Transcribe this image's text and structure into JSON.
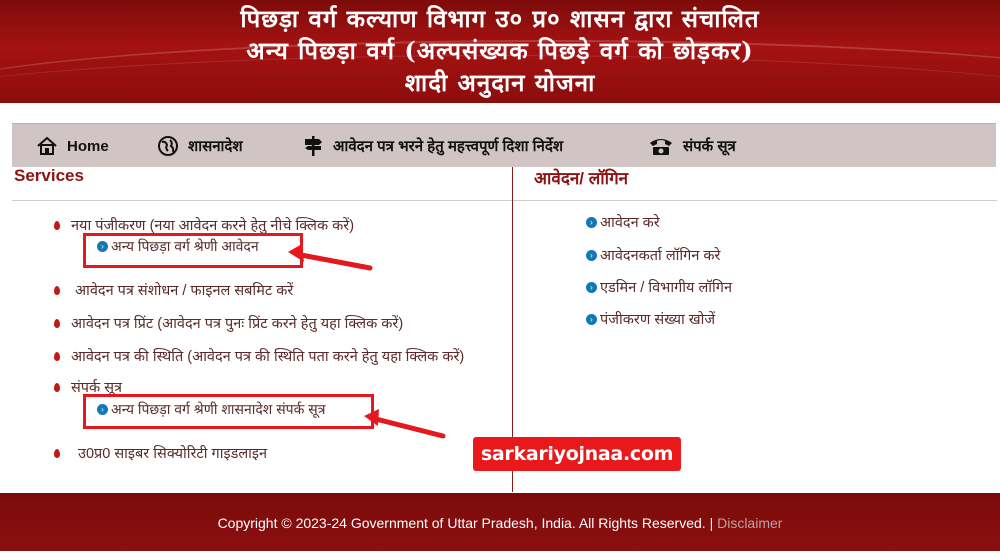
{
  "header": {
    "line1": "पिछड़ा  वर्ग कल्याण विभाग उ० प्र० शासन द्वारा संचालित",
    "line2": "अन्य पिछड़ा वर्ग (अल्पसंख्यक पिछड़े वर्ग को छोड़कर)",
    "line3": "शादी अनुदान योजना"
  },
  "nav": {
    "home": "Home",
    "shasanadesh": "शासनादेश",
    "guidelines": "आवेदन पत्र भरने हेतु महत्त्वपूर्ण दिशा निर्देश",
    "contact": "संपर्क सूत्र"
  },
  "services": {
    "title": "Services",
    "items": [
      "नया पंजीकरण (नया आवेदन करने हेतु नीचे क्लिक करें)",
      "आवेदन पत्र संशोधन / फाइनल सबमिट करें",
      "आवेदन पत्र प्रिंट (आवेदन पत्र पुनः प्रिंट करने हेतु यहा क्लिक करें)",
      "आवेदन पत्र की स्थिति (आवेदन पत्र की स्थिति पता करने हेतु यहा क्लिक करें)",
      "संपर्क सूत्र",
      "उ0प्र0 साइबर सिक्योरिटी गाइडलाइन"
    ],
    "sub_registration": "अन्य पिछड़ा वर्ग श्रेणी आवेदन",
    "sub_contact": "अन्य पिछड़ा वर्ग श्रेणी शासनादेश संपर्क सूत्र"
  },
  "login": {
    "title": "आवेदन/ लॉगिन",
    "items": [
      "आवेदन करे",
      "आवेदनकर्ता लॉगिन करे",
      "एडमिन / विभागीय लॉगिन",
      "पंजीकरण संख्या खोजें"
    ]
  },
  "watermark": "sarkariyojnaa.com",
  "footer": {
    "copyright": "Copyright © 2023-24 Government of Uttar Pradesh, India. All Rights Reserved. | ",
    "disclaimer": "Disclaimer"
  },
  "colors": {
    "header_red": "#a51212",
    "nav_bg": "#d0c4c4",
    "title_red": "#8c1414",
    "highlight_red": "#e4181d",
    "link_circle_blue": "#1478b8"
  }
}
